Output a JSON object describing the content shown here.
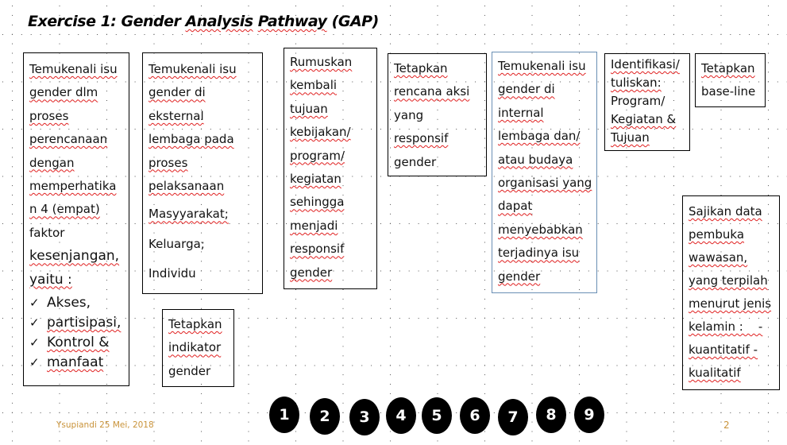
{
  "slide": {
    "title_parts": [
      "Exercise 1: Gender ",
      "Analysis",
      " ",
      "Pathway",
      " (GAP)"
    ],
    "footer_date": "Ysupiandi 25 Mei, 2018",
    "page_number": "2"
  },
  "boxes": {
    "box1": {
      "lines": [
        "Temukenali isu",
        "gender dlm",
        "proses",
        "perencanaan",
        "dengan",
        "memperhatika",
        "n 4 (empat)",
        "faktor"
      ],
      "lines_large": [
        "kesenjangan,",
        "yaitu :"
      ],
      "checklist": [
        "Akses,",
        "partisipasi,",
        "Kontrol &",
        "manfaat"
      ]
    },
    "box2": {
      "lines": [
        "Temukenali isu",
        "gender di",
        "eksternal",
        "lembaga pada",
        "proses",
        "pelaksanaan"
      ],
      "sub_lines": [
        "Masyyarakat;",
        "Keluarga;",
        "Individu"
      ]
    },
    "box3": {
      "lines": [
        "Rumuskan",
        "kembali",
        "tujuan",
        "kebijakan/",
        "program/",
        "kegiatan",
        "sehingga",
        "menjadi",
        "responsif",
        "gender"
      ]
    },
    "box4": {
      "lines": [
        "Tetapkan",
        "rencana aksi",
        "yang",
        "responsif",
        "gender"
      ]
    },
    "box5": {
      "lines": [
        "Temukenali isu",
        "gender di",
        "internal",
        "lembaga dan/",
        "atau budaya",
        "organisasi yang",
        "dapat",
        "menyebabkan",
        "terjadinya isu",
        "gender"
      ]
    },
    "box6": {
      "lines": [
        "Identifikasi/",
        "tuliskan:",
        "Program/",
        "Kegiatan &",
        "Tujuan"
      ]
    },
    "box7": {
      "lines": [
        "Tetapkan",
        "base-line"
      ]
    },
    "box8": {
      "lines": [
        "Sajikan data",
        "pembuka",
        "wawasan,",
        "yang terpilah",
        "menurut jenis",
        "kelamin :    -",
        "kuantitatif -",
        "kualitatif"
      ]
    },
    "box9": {
      "lines": [
        "Tetapkan",
        "indikator",
        "gender"
      ]
    }
  },
  "step_numbers": [
    "1",
    "2",
    "3",
    "4",
    "5",
    "6",
    "7",
    "8",
    "9"
  ],
  "colors": {
    "footer_text": "#c9933a",
    "box_border": "#000000",
    "box_blue_border": "#6a8fb4",
    "spellcheck_underline": "#e02020",
    "circle_fill": "#000000"
  }
}
